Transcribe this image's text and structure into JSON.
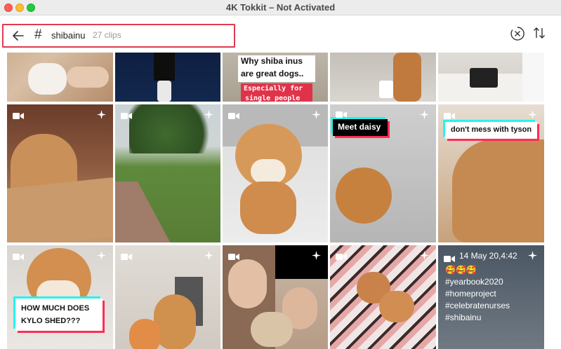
{
  "window": {
    "title": "4K Tokkit – Not Activated"
  },
  "search": {
    "hashtag": "shibainu",
    "clip_count": "27 clips"
  },
  "captions": {
    "shiba_line1": "Why shiba inus",
    "shiba_line2": "are great dogs..",
    "shiba_pink1": "Especially for",
    "shiba_pink2": "single people",
    "meet_daisy": "Meet daisy",
    "dont_mess": "don't mess with tyson",
    "kylo1": "HOW MUCH DOES",
    "kylo2": "KYLO SHED???"
  },
  "clip_meta": {
    "date": "14 May 20,4:42",
    "emojis": "🥰🥰🥰",
    "tags": [
      "#yearbook2020",
      "#homeproject",
      "#celebratenurses",
      "#shibainu"
    ]
  },
  "colors": {
    "accent": "#e03a4f",
    "tiktok_cyan": "#25f4ee",
    "tiktok_red": "#fe2c55"
  },
  "icons": {
    "back": "arrow-left-icon",
    "hash": "hash-icon",
    "clear": "circle-x-icon",
    "sort": "sort-arrows-icon",
    "video": "video-camera-icon",
    "sparkle": "sparkle-icon"
  }
}
